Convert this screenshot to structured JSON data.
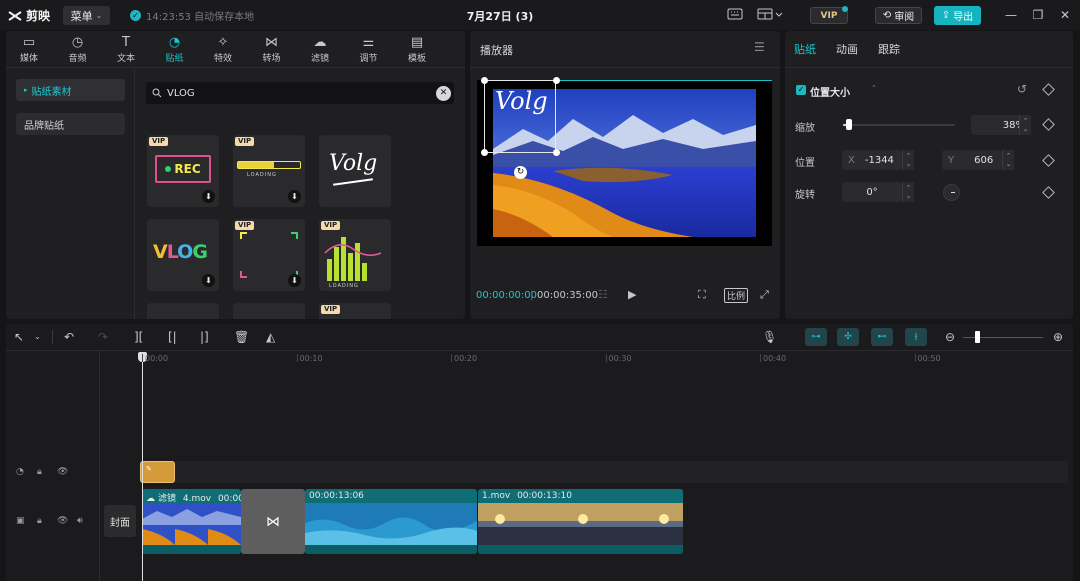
{
  "app": {
    "logo_text": "剪映",
    "menu_label": "菜单",
    "save_status": "14:23:53 自动保存本地",
    "project_title": "7月27日 (3)",
    "vip_label": "VIP",
    "review_label": "审阅",
    "export_label": "导出"
  },
  "media": {
    "tabs": [
      {
        "label": "媒体",
        "icon": "media-icon"
      },
      {
        "label": "音频",
        "icon": "audio-icon"
      },
      {
        "label": "文本",
        "icon": "text-icon"
      },
      {
        "label": "贴纸",
        "icon": "sticker-icon"
      },
      {
        "label": "特效",
        "icon": "effects-icon"
      },
      {
        "label": "转场",
        "icon": "transition-icon"
      },
      {
        "label": "滤镜",
        "icon": "filter-icon"
      },
      {
        "label": "调节",
        "icon": "adjust-icon"
      },
      {
        "label": "模板",
        "icon": "template-icon"
      }
    ],
    "active_tab": "贴纸",
    "sidebar": [
      "贴纸素材",
      "品牌贴纸"
    ],
    "search_value": "VLOG",
    "stickers": [
      {
        "text": "REC",
        "vip": true
      },
      {
        "text": "LOADING",
        "vip": true
      },
      {
        "text": "Volg",
        "vip": false
      },
      {
        "text": "VLOG",
        "vip": false
      },
      {
        "text": "",
        "vip": true
      },
      {
        "text": "LOADING",
        "vip": true
      }
    ],
    "vip_tag": "VIP"
  },
  "player": {
    "title": "播放器",
    "overlay_text": "Volg",
    "current_time": "00:00:00:00",
    "duration": "00:00:35:00",
    "ratio_label": "比例"
  },
  "props": {
    "tabs": [
      "贴纸",
      "动画",
      "跟踪"
    ],
    "active_tab": "贴纸",
    "section_title": "位置大小",
    "scale_label": "缩放",
    "scale_value": "38%",
    "scale_fraction": 0.38,
    "position_label": "位置",
    "x_label": "X",
    "x_value": "-1344",
    "y_label": "Y",
    "y_value": "606",
    "rotate_label": "旋转",
    "rotate_value": "0°"
  },
  "timeline": {
    "ruler": [
      "00:00",
      "00:10",
      "00:20",
      "00:30",
      "00:40",
      "00:50"
    ],
    "cover_label": "封面",
    "clips": [
      {
        "filter": "滤镜",
        "name": "4.mov",
        "time": "00:00"
      },
      {
        "name": "",
        "time": "00:00:13:06"
      },
      {
        "name": "1.mov",
        "time": "00:00:13:10"
      }
    ]
  },
  "colors": {
    "accent": "#1fb6c0",
    "clip": "#0f6d76",
    "sticker_clip": "#d49b3a"
  }
}
